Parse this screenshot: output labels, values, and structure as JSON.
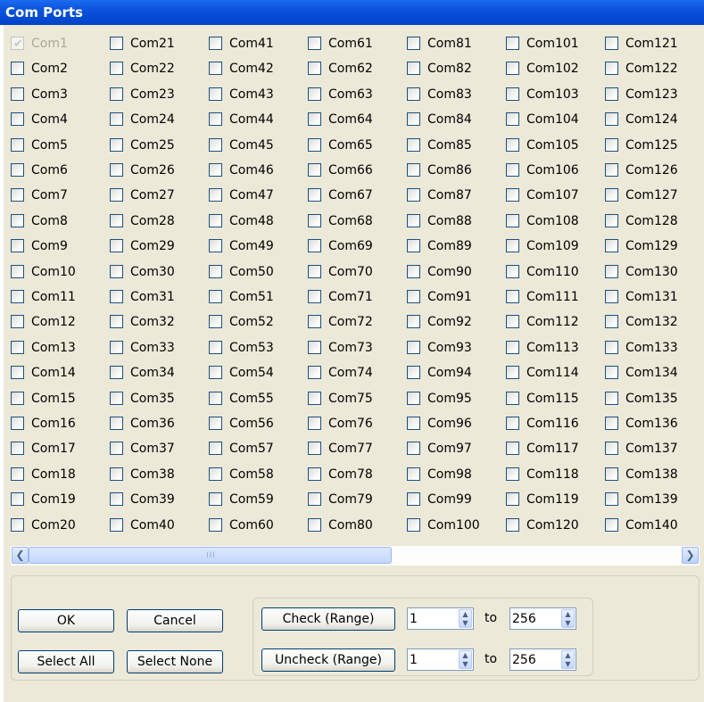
{
  "window": {
    "title": "Com Ports"
  },
  "columns": [
    [
      "Com1",
      "Com2",
      "Com3",
      "Com4",
      "Com5",
      "Com6",
      "Com7",
      "Com8",
      "Com9",
      "Com10",
      "Com11",
      "Com12",
      "Com13",
      "Com14",
      "Com15",
      "Com16",
      "Com17",
      "Com18",
      "Com19",
      "Com20"
    ],
    [
      "Com21",
      "Com22",
      "Com23",
      "Com24",
      "Com25",
      "Com26",
      "Com27",
      "Com28",
      "Com29",
      "Com30",
      "Com31",
      "Com32",
      "Com33",
      "Com34",
      "Com35",
      "Com36",
      "Com37",
      "Com38",
      "Com39",
      "Com40"
    ],
    [
      "Com41",
      "Com42",
      "Com43",
      "Com44",
      "Com45",
      "Com46",
      "Com47",
      "Com48",
      "Com49",
      "Com50",
      "Com51",
      "Com52",
      "Com53",
      "Com54",
      "Com55",
      "Com56",
      "Com57",
      "Com58",
      "Com59",
      "Com60"
    ],
    [
      "Com61",
      "Com62",
      "Com63",
      "Com64",
      "Com65",
      "Com66",
      "Com67",
      "Com68",
      "Com69",
      "Com70",
      "Com71",
      "Com72",
      "Com73",
      "Com74",
      "Com75",
      "Com76",
      "Com77",
      "Com78",
      "Com79",
      "Com80"
    ],
    [
      "Com81",
      "Com82",
      "Com83",
      "Com84",
      "Com85",
      "Com86",
      "Com87",
      "Com88",
      "Com89",
      "Com90",
      "Com91",
      "Com92",
      "Com93",
      "Com94",
      "Com95",
      "Com96",
      "Com97",
      "Com98",
      "Com99",
      "Com100"
    ],
    [
      "Com101",
      "Com102",
      "Com103",
      "Com104",
      "Com105",
      "Com106",
      "Com107",
      "Com108",
      "Com109",
      "Com110",
      "Com111",
      "Com112",
      "Com113",
      "Com114",
      "Com115",
      "Com116",
      "Com117",
      "Com118",
      "Com119",
      "Com120"
    ],
    [
      "Com121",
      "Com122",
      "Com123",
      "Com124",
      "Com125",
      "Com126",
      "Com127",
      "Com128",
      "Com129",
      "Com130",
      "Com131",
      "Com132",
      "Com133",
      "Com134",
      "Com135",
      "Com136",
      "Com137",
      "Com138",
      "Com139",
      "Com140"
    ]
  ],
  "checkbox_state": {
    "Com1": {
      "checked": true,
      "disabled": true
    },
    "others": {
      "checked": false,
      "disabled": false
    }
  },
  "scrollbar": {
    "left_icon": "scroll-left-arrow-icon",
    "right_icon": "scroll-right-arrow-icon",
    "grip_icon": "grip-icon",
    "thumb_glyph": "III"
  },
  "buttons": {
    "ok": "OK",
    "cancel": "Cancel",
    "select_all": "Select All",
    "select_none": "Select None",
    "check_range": "Check (Range)",
    "uncheck_range": "Uncheck (Range)"
  },
  "range": {
    "check_from": "1",
    "check_to": "256",
    "uncheck_from": "1",
    "uncheck_to": "256",
    "to_label": "to"
  },
  "colors": {
    "titlebar": "#0a52dd",
    "window_bg": "#ece9d8",
    "checkbox_border": "#1c5180",
    "button_border": "#003c74"
  }
}
